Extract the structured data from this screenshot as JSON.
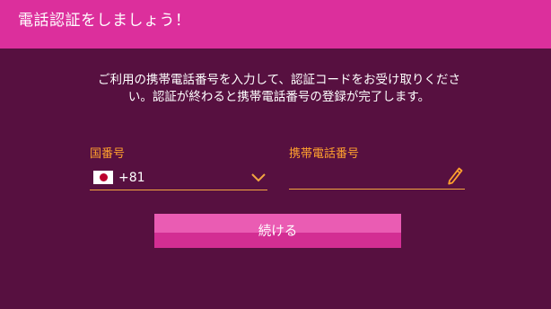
{
  "header": {
    "title": "電話認証をしましょう！"
  },
  "description": "ご利用の携帯電話番号を入力して、認証コードをお受け取りください。認証が終わると携帯電話番号の登録が完了します。",
  "country_field": {
    "label": "国番号",
    "selected_value": "+81",
    "flag_icon": "japan-flag-icon"
  },
  "phone_field": {
    "label": "携帯電話番号",
    "value": "",
    "edit_icon": "pencil-icon"
  },
  "continue_button": {
    "label": "続ける"
  },
  "colors": {
    "header_background": "#dc2f9c",
    "body_background": "#571040",
    "label_accent": "#ffa12e",
    "underline": "#f3a640",
    "button_top": "#ea5cb3",
    "button_bottom": "#d32e93"
  }
}
